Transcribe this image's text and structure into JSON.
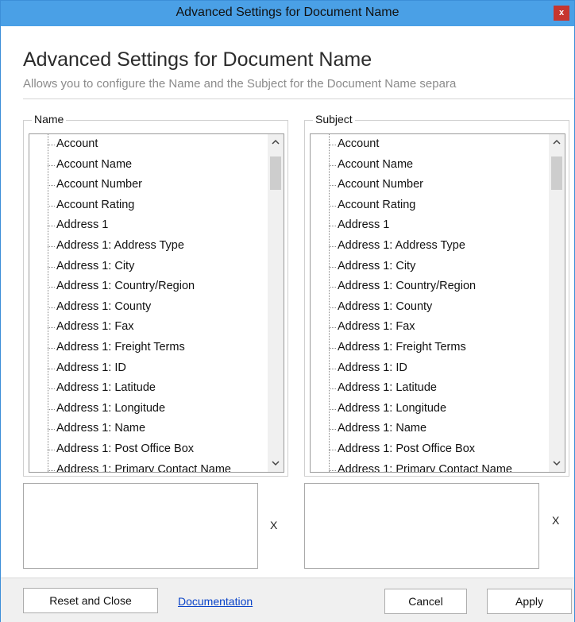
{
  "window": {
    "title": "Advanced Settings for Document Name",
    "close_label": "x"
  },
  "header": {
    "title": "Advanced Settings for Document Name",
    "description": "Allows you to configure the Name and the Subject for the Document Name separa"
  },
  "name_panel": {
    "legend": "Name",
    "items": [
      "Account",
      "Account Name",
      "Account Number",
      "Account Rating",
      "Address 1",
      "Address 1: Address Type",
      "Address 1: City",
      "Address 1: Country/Region",
      "Address 1: County",
      "Address 1: Fax",
      "Address 1: Freight Terms",
      "Address 1: ID",
      "Address 1: Latitude",
      "Address 1: Longitude",
      "Address 1: Name",
      "Address 1: Post Office Box",
      "Address 1: Primary Contact Name"
    ],
    "expression_value": "",
    "clear_label": "X"
  },
  "subject_panel": {
    "legend": "Subject",
    "items": [
      "Account",
      "Account Name",
      "Account Number",
      "Account Rating",
      "Address 1",
      "Address 1: Address Type",
      "Address 1: City",
      "Address 1: Country/Region",
      "Address 1: County",
      "Address 1: Fax",
      "Address 1: Freight Terms",
      "Address 1: ID",
      "Address 1: Latitude",
      "Address 1: Longitude",
      "Address 1: Name",
      "Address 1: Post Office Box",
      "Address 1: Primary Contact Name"
    ],
    "expression_value": "",
    "clear_label": "X"
  },
  "footer": {
    "reset_label": "Reset and Close",
    "documentation_label": "Documentation",
    "cancel_label": "Cancel",
    "apply_label": "Apply"
  },
  "icons": {
    "scroll_up": "chevron-up-icon",
    "scroll_down": "chevron-down-icon",
    "close": "close-icon"
  },
  "colors": {
    "titlebar": "#4aa0e6",
    "close_button": "#c7362f",
    "link": "#0b44c8"
  }
}
